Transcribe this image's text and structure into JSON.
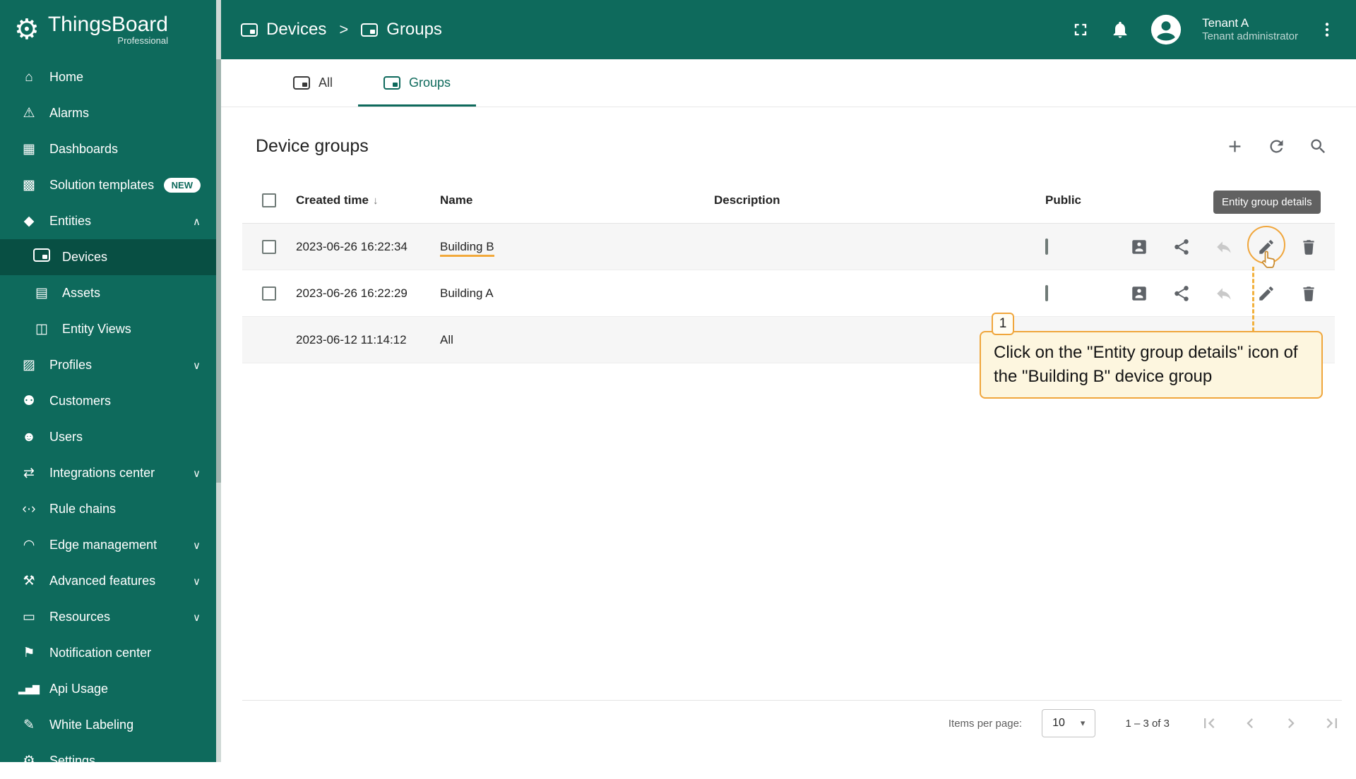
{
  "app": {
    "name": "ThingsBoard",
    "edition": "Professional"
  },
  "topbar": {
    "separator": ">",
    "breadcrumb": [
      {
        "label": "Devices"
      },
      {
        "label": "Groups"
      }
    ],
    "user": {
      "name": "Tenant A",
      "role": "Tenant administrator"
    }
  },
  "sidebar": {
    "items": [
      {
        "label": "Home",
        "glyph": "⌂"
      },
      {
        "label": "Alarms",
        "glyph": "⚠"
      },
      {
        "label": "Dashboards",
        "glyph": "▦"
      },
      {
        "label": "Solution templates",
        "glyph": "▩",
        "badge": "NEW"
      },
      {
        "label": "Entities",
        "glyph": "◆",
        "caret": "∧"
      },
      {
        "label": "Devices",
        "sub": true,
        "active": true
      },
      {
        "label": "Assets",
        "glyph": "▤",
        "sub": true
      },
      {
        "label": "Entity Views",
        "glyph": "◫",
        "sub": true
      },
      {
        "label": "Profiles",
        "glyph": "▨",
        "caret": "∨"
      },
      {
        "label": "Customers",
        "glyph": "⚉"
      },
      {
        "label": "Users",
        "glyph": "☻"
      },
      {
        "label": "Integrations center",
        "glyph": "⇄",
        "caret": "∨"
      },
      {
        "label": "Rule chains",
        "glyph": "‹·›"
      },
      {
        "label": "Edge management",
        "glyph": "◠",
        "caret": "∨"
      },
      {
        "label": "Advanced features",
        "glyph": "⚒",
        "caret": "∨"
      },
      {
        "label": "Resources",
        "glyph": "▭",
        "caret": "∨"
      },
      {
        "label": "Notification center",
        "glyph": "⚑"
      },
      {
        "label": "Api Usage",
        "glyph": "▂▅▇"
      },
      {
        "label": "White Labeling",
        "glyph": "✎"
      },
      {
        "label": "Settings",
        "glyph": "⚙"
      }
    ]
  },
  "tabs": [
    {
      "label": "All"
    },
    {
      "label": "Groups",
      "active": true
    }
  ],
  "card": {
    "title": "Device groups"
  },
  "table": {
    "columns": {
      "created": "Created time",
      "name": "Name",
      "description": "Description",
      "public": "Public"
    },
    "sort_arrow": "↓",
    "rows": [
      {
        "created": "2023-06-26 16:22:34",
        "name": "Building B",
        "description": "",
        "public": false
      },
      {
        "created": "2023-06-26 16:22:29",
        "name": "Building A",
        "description": "",
        "public": false
      },
      {
        "created": "2023-06-12 11:14:12",
        "name": "All",
        "description": "",
        "public": false
      }
    ]
  },
  "tooltip": {
    "text": "Entity group details"
  },
  "annotation": {
    "step": "1",
    "text": "Click on the \"Entity group details\" icon of the \"Building B\" device group",
    "accent_color": "#f0a63c"
  },
  "paginator": {
    "items_per_page_label": "Items per page:",
    "items_per_page": "10",
    "caret": "▾",
    "range_label": "1 – 3 of 3"
  },
  "colors": {
    "sidebar": "#0e6a5c",
    "accent": "#0e6a5c",
    "annotation": "#f0a63c",
    "tooltip_bg": "#616161"
  },
  "icons": {
    "fullscreen": "svg-corners",
    "notifications": "svg-bell",
    "avatar": "svg-person-circle",
    "more-menu": "svg-kebab",
    "add": "svg-plus",
    "refresh": "svg-arrow-circle",
    "search": "svg-magnifier",
    "group-users": "svg-contact-card",
    "share": "svg-share",
    "undo": "svg-reply",
    "edit": "svg-pencil",
    "delete": "svg-trash",
    "first-page": "svg",
    "previous-page": "svg",
    "next-page": "svg",
    "last-page": "svg",
    "devices": "css-rounded-rect",
    "sort": "↓",
    "select-caret": "▾"
  }
}
